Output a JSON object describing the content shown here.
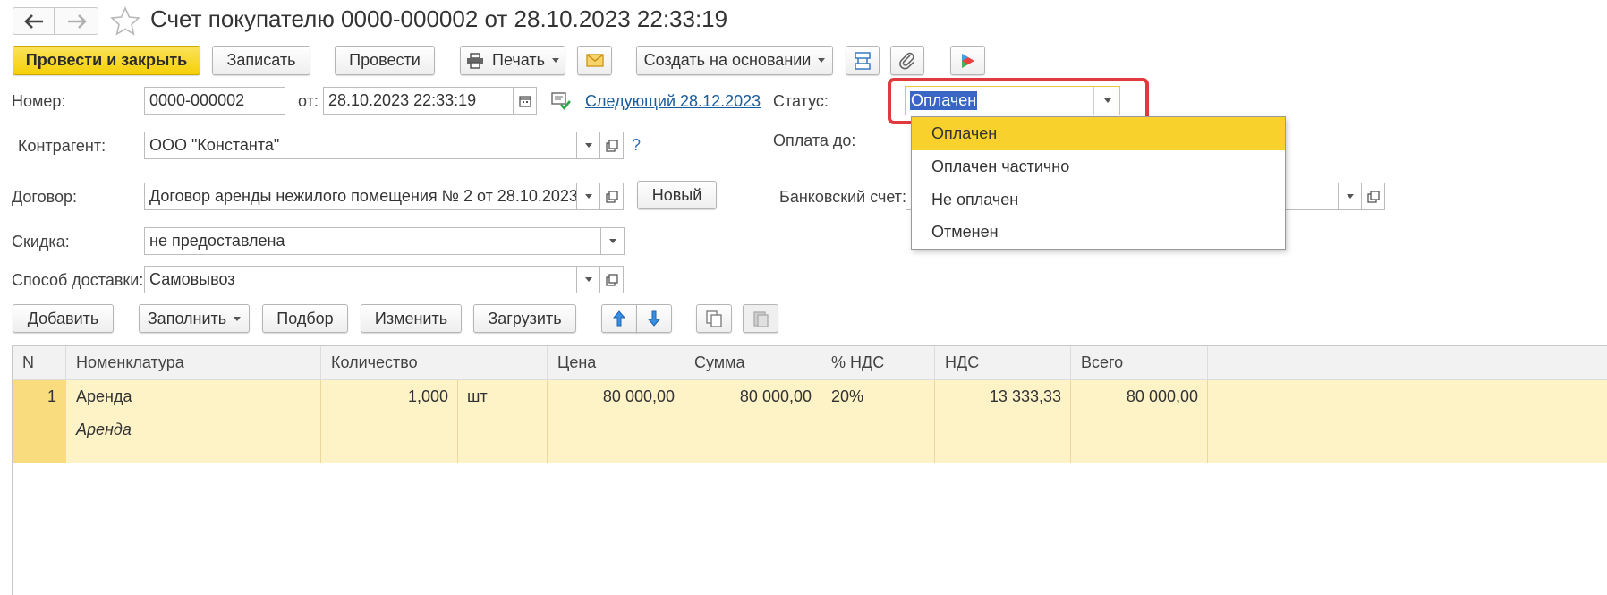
{
  "window": {
    "title": "Счет покупателю 0000-000002 от 28.10.2023 22:33:19"
  },
  "toolbar": {
    "post_and_close": "Провести и закрыть",
    "save": "Записать",
    "post": "Провести",
    "print": "Печать",
    "create_based": "Создать на основании"
  },
  "form": {
    "number_label": "Номер:",
    "number_value": "0000-000002",
    "date_label": "от:",
    "date_value": "28.10.2023 22:33:19",
    "next_link": "Следующий 28.12.2023",
    "status_label": "Статус:",
    "status_value": "Оплачен",
    "counterparty_label": "Контрагент:",
    "counterparty_value": "ООО \"Константа\"",
    "question_mark": "?",
    "pay_until_label": "Оплата до:",
    "contract_label": "Договор:",
    "contract_value": "Договор аренды нежилого помещения № 2 от 28.10.2023",
    "new_button": "Новый",
    "bank_account_label": "Банковский счет:",
    "discount_label": "Скидка:",
    "discount_value": "не предоставлена",
    "delivery_label": "Способ доставки:",
    "delivery_value": "Самовывоз"
  },
  "status_dropdown": {
    "options": [
      "Оплачен",
      "Оплачен частично",
      "Не оплачен",
      "Отменен"
    ],
    "highlight_color": "#f9d12c",
    "callout_color": "#e0393e"
  },
  "table_toolbar": {
    "add": "Добавить",
    "fill": "Заполнить",
    "pick": "Подбор",
    "edit": "Изменить",
    "load": "Загрузить"
  },
  "table": {
    "columns": [
      "N",
      "Номенклатура",
      "Количество",
      "Цена",
      "Сумма",
      "% НДС",
      "НДС",
      "Всего"
    ],
    "rows": [
      {
        "n": "1",
        "item": "Аренда",
        "item_sub": "Аренда",
        "qty": "1,000",
        "unit": "шт",
        "price": "80 000,00",
        "sum": "80 000,00",
        "vat_rate": "20%",
        "vat": "13 333,33",
        "total": "80 000,00"
      }
    ]
  },
  "colors": {
    "primary_button": "#f5d008",
    "row_highlight": "#fdf3c7",
    "link": "#1a5c9c"
  }
}
